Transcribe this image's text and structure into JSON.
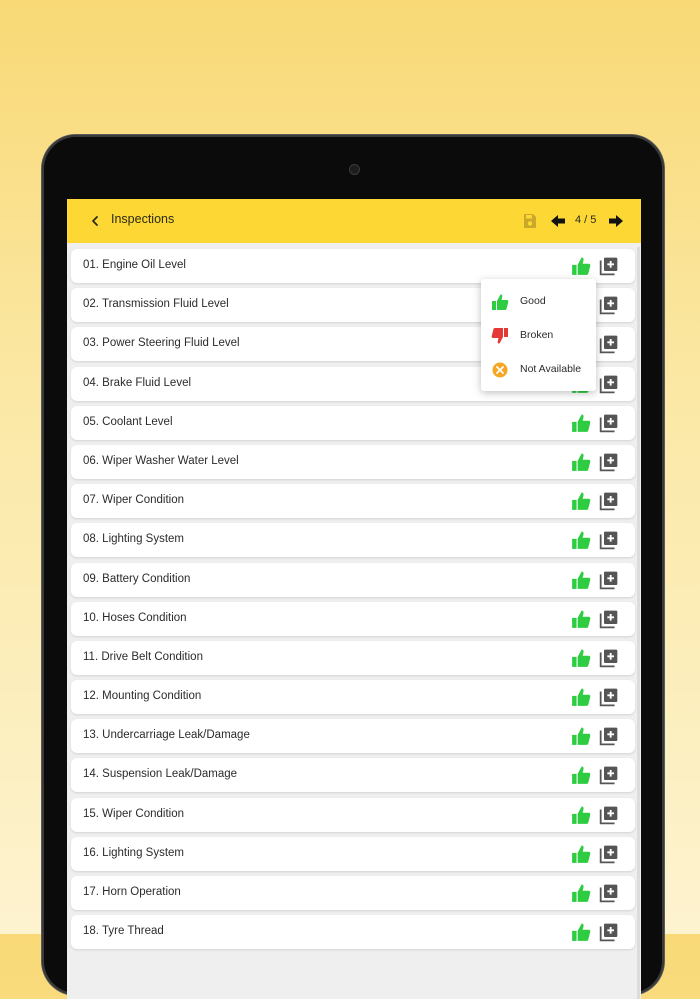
{
  "app": {
    "title": "Inspections",
    "pager": "4 / 5"
  },
  "colors": {
    "accent": "#fdd835",
    "good": "#2ecc40",
    "broken": "#e53935",
    "not_available": "#f5a623"
  },
  "icons": {
    "back": "chevron-left-icon",
    "save": "save-icon",
    "prev": "arrow-left-icon",
    "next": "arrow-right-icon",
    "thumb": "thumbs-up-icon",
    "add": "add-photo-icon"
  },
  "items": [
    {
      "label": "01. Engine Oil Level",
      "status": "good"
    },
    {
      "label": "02. Transmission Fluid Level",
      "status": "good"
    },
    {
      "label": "03. Power Steering Fluid Level",
      "status": "good"
    },
    {
      "label": "04. Brake Fluid Level",
      "status": "good"
    },
    {
      "label": "05. Coolant Level",
      "status": "good"
    },
    {
      "label": "06. Wiper Washer Water Level",
      "status": "good"
    },
    {
      "label": "07. Wiper Condition",
      "status": "good"
    },
    {
      "label": "08. Lighting System",
      "status": "good"
    },
    {
      "label": "09. Battery Condition",
      "status": "good"
    },
    {
      "label": "10. Hoses Condition",
      "status": "good"
    },
    {
      "label": "11. Drive Belt Condition",
      "status": "good"
    },
    {
      "label": "12. Mounting Condition",
      "status": "good"
    },
    {
      "label": "13. Undercarriage Leak/Damage",
      "status": "good"
    },
    {
      "label": "14. Suspension Leak/Damage",
      "status": "good"
    },
    {
      "label": "15. Wiper Condition",
      "status": "good"
    },
    {
      "label": "16. Lighting System",
      "status": "good"
    },
    {
      "label": "17. Horn Operation",
      "status": "good"
    },
    {
      "label": "18. Tyre Thread",
      "status": "good"
    }
  ],
  "popup": {
    "options": [
      {
        "label": "Good",
        "icon": "thumbs-up-icon"
      },
      {
        "label": "Broken",
        "icon": "thumbs-down-icon"
      },
      {
        "label": "Not Available",
        "icon": "close-circle-icon"
      }
    ]
  }
}
